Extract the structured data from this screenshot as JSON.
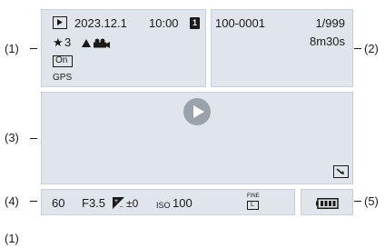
{
  "callouts": {
    "c1": "(1)",
    "c2": "(2)",
    "c3": "(3)",
    "c4": "(4)",
    "c5": "(5)",
    "footer": "(1)"
  },
  "info_left": {
    "date": "2023.12.1",
    "time": "10:00",
    "card_slot": "1",
    "rating": "3",
    "protect_label": "On",
    "gps_label": "GPS"
  },
  "info_right": {
    "file_number": "100-0001",
    "image_count": "1/999",
    "duration": "8m30s"
  },
  "bottom_bar": {
    "shutter": "60",
    "aperture": "F3.5",
    "exposure_comp": "±0",
    "iso_prefix": "ISO",
    "iso_value": "100",
    "quality_top": "FINE",
    "quality_bottom": "L"
  },
  "icons": [
    "playback-mode-icon",
    "star-icon",
    "protect-icon",
    "gps-icon",
    "play-icon",
    "video-crop-icon",
    "exposure-comp-icon",
    "battery-icon"
  ],
  "colors": {
    "panel_bg": "#dfe5ea",
    "panel_border": "#c9d0d6",
    "play_button": "#9aa3ab",
    "text": "#1a1a1a"
  }
}
